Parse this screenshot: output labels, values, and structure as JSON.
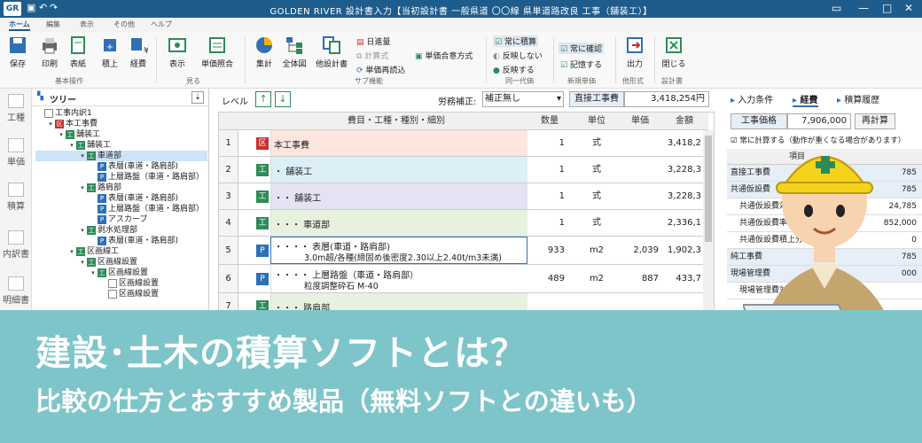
{
  "titlebar": {
    "logo": "GR",
    "title": "GOLDEN RIVER  設計書入力【当初設計書 一般県道 〇〇線 県単道路改良 工事（舗装工）】"
  },
  "menu_tabs": [
    "ホーム",
    "編集",
    "表示",
    "その他",
    "ヘルプ"
  ],
  "ribbon": {
    "buttons": [
      "保存",
      "印刷",
      "表紙",
      "積上",
      "経費",
      "表示",
      "単価照合",
      "集計",
      "全体図",
      "他設計書"
    ],
    "small_buttons": [
      "日進量",
      "計算式",
      "単価再読込",
      "単価合意方式",
      "常に積算",
      "反映しない",
      "反映する",
      "常に確認",
      "記憶する",
      "出力",
      "閉じる"
    ],
    "groups": [
      "基本操作",
      "見る",
      "サブ機能",
      "同一代価",
      "新規単価",
      "他形式",
      "設計書"
    ]
  },
  "leftbar": [
    "工種",
    "単価",
    "積算",
    "内訳書",
    "明細書"
  ],
  "tree": {
    "title": "ツリー",
    "nodes": [
      {
        "indent": 0,
        "badge": "",
        "label": "工事内訳1"
      },
      {
        "indent": 1,
        "badge": "区",
        "label": "本工事費"
      },
      {
        "indent": 2,
        "badge": "工",
        "label": "舗装工"
      },
      {
        "indent": 3,
        "badge": "工",
        "label": "舗装工"
      },
      {
        "indent": 4,
        "badge": "工",
        "label": "車道部",
        "selected": true
      },
      {
        "indent": 5,
        "badge": "P",
        "label": "表層(車道・路肩部)"
      },
      {
        "indent": 5,
        "badge": "P",
        "label": "上層路盤（車道・路肩部）"
      },
      {
        "indent": 4,
        "badge": "工",
        "label": "路肩部"
      },
      {
        "indent": 5,
        "badge": "P",
        "label": "表層(車道・路肩部)"
      },
      {
        "indent": 5,
        "badge": "P",
        "label": "上層路盤（車道・路肩部）"
      },
      {
        "indent": 5,
        "badge": "P",
        "label": "アスカーブ"
      },
      {
        "indent": 4,
        "badge": "工",
        "label": "剥水処理部"
      },
      {
        "indent": 5,
        "badge": "P",
        "label": "表層(車道・路肩部)"
      },
      {
        "indent": 3,
        "badge": "工",
        "label": "区画線工"
      },
      {
        "indent": 4,
        "badge": "工",
        "label": "区画線設置"
      },
      {
        "indent": 5,
        "badge": "工",
        "label": "区画線設置"
      },
      {
        "indent": 6,
        "badge": "",
        "label": "区画線設置"
      },
      {
        "indent": 6,
        "badge": "",
        "label": "区画線設置"
      }
    ]
  },
  "toolbar": {
    "level_label": "レベル",
    "labor_label": "労務補正:",
    "labor_value": "補正無し",
    "direct_label": "直接工事費",
    "direct_value": "3,418,254円"
  },
  "grid": {
    "headers": [
      "費目・工種・種別・細別",
      "数量",
      "単位",
      "単価",
      "金額"
    ],
    "rows": [
      {
        "num": "1",
        "badge": "区",
        "color": "#c8302e",
        "bg": "#fde6df",
        "dots": "",
        "name": "本工事費",
        "sub": "",
        "qty": "1",
        "unit": "式",
        "price": "",
        "amount": "3,418,2"
      },
      {
        "num": "2",
        "badge": "工",
        "color": "#2e8b57",
        "bg": "#dceff7",
        "dots": "・",
        "name": "舗装工",
        "sub": "",
        "qty": "1",
        "unit": "式",
        "price": "",
        "amount": "3,228,3"
      },
      {
        "num": "3",
        "badge": "工",
        "color": "#2e8b57",
        "bg": "#e6e1f3",
        "dots": "・・",
        "name": "舗装工",
        "sub": "",
        "qty": "1",
        "unit": "式",
        "price": "",
        "amount": "3,228,3"
      },
      {
        "num": "4",
        "badge": "工",
        "color": "#2e8b57",
        "bg": "#e7f2de",
        "dots": "・・・",
        "name": "車道部",
        "sub": "",
        "qty": "1",
        "unit": "式",
        "price": "",
        "amount": "2,336,1"
      },
      {
        "num": "5",
        "badge": "P",
        "color": "#2f6fb5",
        "bg": "#ffffff",
        "dots": "・・・・",
        "name": "表層(車道・路肩部)",
        "sub": "3.0m超/各種(締固め後密度2.30以上2.40t/m3未満)",
        "qty": "933",
        "unit": "m2",
        "price": "2,039",
        "amount": "1,902,3"
      },
      {
        "num": "6",
        "badge": "P",
        "color": "#2f6fb5",
        "bg": "#ffffff",
        "dots": "・・・・",
        "name": "上層路盤（車道・路肩部）",
        "sub": "粒度調整砕石 M-40",
        "qty": "489",
        "unit": "m2",
        "price": "887",
        "amount": "433,7"
      },
      {
        "num": "7",
        "badge": "工",
        "color": "#2e8b57",
        "bg": "#e7f2de",
        "dots": "・・・",
        "name": "路肩部",
        "sub": "",
        "qty": "",
        "unit": "",
        "price": "",
        "amount": ""
      }
    ]
  },
  "rpanel": {
    "tabs": [
      "入力条件",
      "経費",
      "積算履歴"
    ],
    "cost_label": "工事価格",
    "cost_value": "7,906,000",
    "recalc": "再計算",
    "check_label": "常に計算する（動作が重くなる場合があります）",
    "col_header": "項目",
    "rows": [
      {
        "label": "直接工事費",
        "value": "785",
        "hl": true
      },
      {
        "label": "共通仮設費",
        "value": "785",
        "hl": true
      },
      {
        "label": "共通仮設費対象額",
        "value": "24,785",
        "hl": false
      },
      {
        "label": "共通仮設費率分",
        "value": "852,000",
        "hl": false
      },
      {
        "label": "共通仮設費積上分",
        "value": "0",
        "hl": false
      },
      {
        "label": "純工事費",
        "value": "785",
        "hl": true
      },
      {
        "label": "現場管理費",
        "value": "000",
        "hl": true
      },
      {
        "label": "現場管理費対象",
        "value": "",
        "hl": false
      }
    ]
  },
  "banner": {
    "title": "建設･土木の積算ソフトとは？",
    "subtitle": "比較の仕方とおすすめ製品（無料ソフトとの違いも）"
  },
  "colors": {
    "accent": "#1e5c8c",
    "banner": "#7ec5c9",
    "helmet": "#f4d31a"
  }
}
